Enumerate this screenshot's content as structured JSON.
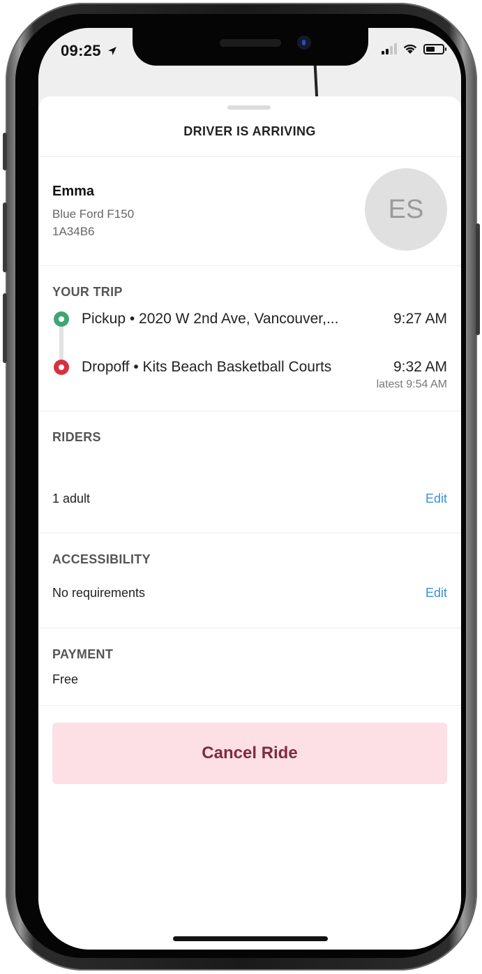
{
  "status_bar": {
    "time": "09:25",
    "location_icon": "location-arrow-icon",
    "signal_icon": "cellular-signal-icon",
    "wifi_icon": "wifi-icon",
    "battery_icon": "battery-icon"
  },
  "sheet": {
    "title": "DRIVER IS ARRIVING"
  },
  "driver": {
    "name": "Emma",
    "vehicle": "Blue Ford F150",
    "plate": "1A34B6",
    "initials": "ES"
  },
  "trip": {
    "label": "YOUR TRIP",
    "pickup": {
      "text": "Pickup • 2020 W 2nd Ave, Vancouver,...",
      "time": "9:27 AM",
      "color": "#3fa672"
    },
    "dropoff": {
      "text": "Dropoff • Kits Beach Basketball Courts",
      "time": "9:32 AM",
      "latest": "latest 9:54 AM",
      "color": "#d8303f"
    }
  },
  "riders": {
    "label": "RIDERS",
    "value": "1 adult",
    "edit_label": "Edit"
  },
  "accessibility": {
    "label": "ACCESSIBILITY",
    "value": "No requirements",
    "edit_label": "Edit"
  },
  "payment": {
    "label": "PAYMENT",
    "value": "Free"
  },
  "cancel_button": {
    "label": "Cancel Ride",
    "background": "#fde0e6",
    "text_color": "#7e2b3f"
  },
  "colors": {
    "link": "#3b8fd6"
  }
}
